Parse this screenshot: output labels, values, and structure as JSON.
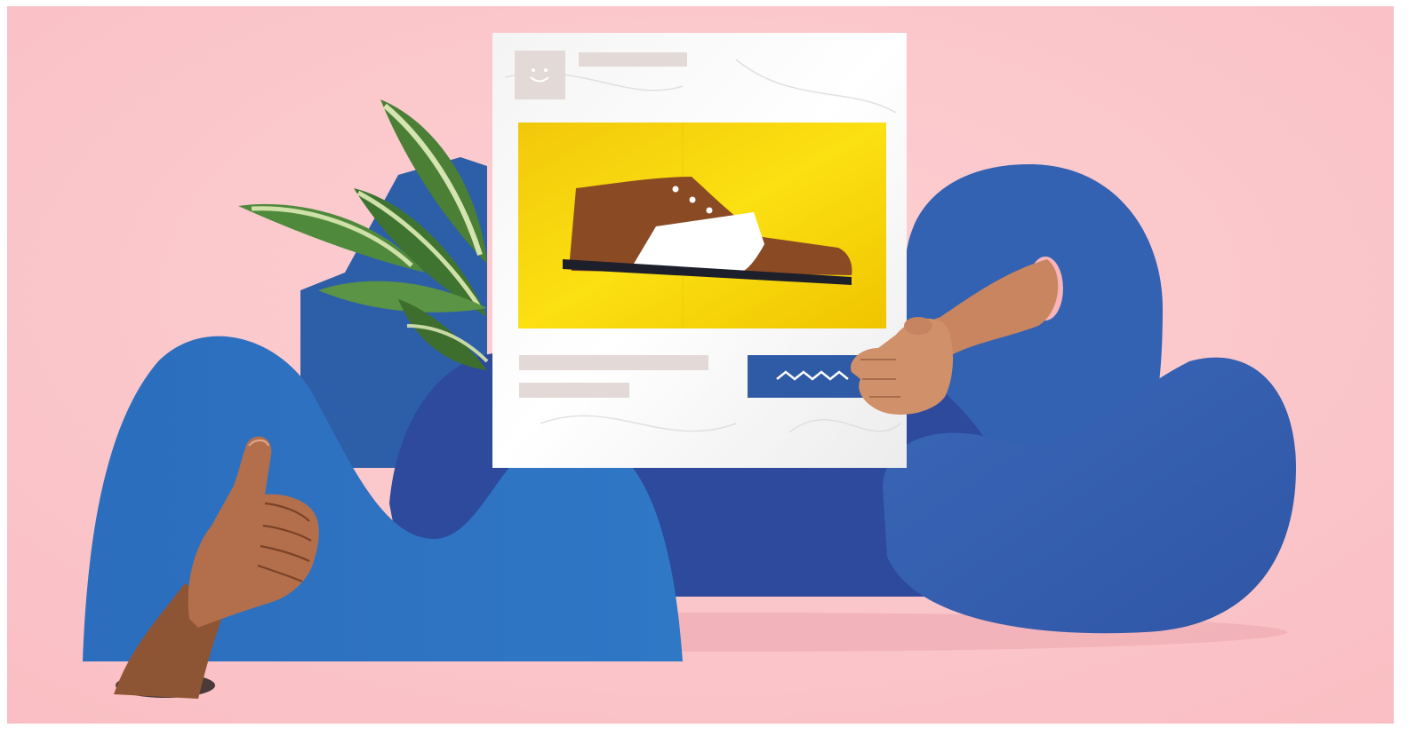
{
  "scene": {
    "background_color": "#fbc5c9",
    "shape_colors": {
      "light_blue": "#2f72c0",
      "mid_blue": "#2c5fb0",
      "dark_blue": "#2e4fa0",
      "yellow": "#f7d40a",
      "shoe_brown": "#8a4a24",
      "shoe_white": "#ffffff",
      "sole": "#1d1f2a",
      "skin": "#c98560",
      "skin_dark": "#8e5534",
      "leaf_green": "#4a7b36",
      "leaf_light": "#c8d9a5",
      "placeholder_bar": "#e3d9d6",
      "button_blue": "#2f5aa6"
    },
    "icons": [
      "smiley-icon",
      "squiggle-icon"
    ]
  },
  "card": {
    "type": "product-card mockup",
    "avatar_icon": "smiley-icon",
    "product_icon": "shoe-icon",
    "button_icon": "squiggle-icon"
  }
}
